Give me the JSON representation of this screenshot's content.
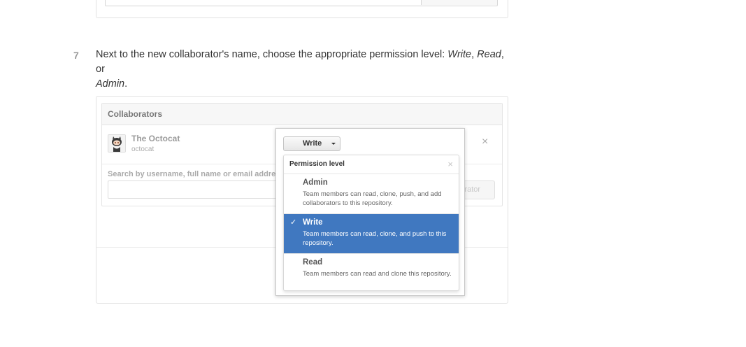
{
  "step": {
    "number": "7",
    "text_before": "Next to the new collaborator's name, choose the appropriate permission level: ",
    "opt1": "Write",
    "sep1": ", ",
    "opt2": "Read",
    "sep2": ", or",
    "opt3": "Admin",
    "end": "."
  },
  "collaborators": {
    "header": "Collaborators",
    "user_name": "The Octocat",
    "user_login": "octocat",
    "remove_icon": "close-icon",
    "search_label": "Search by username, full name or email address",
    "add_button_label": "Add collaborator"
  },
  "permission_menu": {
    "button_label": "Write",
    "header": "Permission level",
    "items": [
      {
        "title": "Admin",
        "desc": "Team members can read, clone, push, and add collaborators to this repository.",
        "selected": false
      },
      {
        "title": "Write",
        "desc": "Team members can read, clone, and push to this repository.",
        "selected": true
      },
      {
        "title": "Read",
        "desc": "Team members can read and clone this repository.",
        "selected": false
      }
    ]
  },
  "colors": {
    "selected_bg": "#4078c0"
  }
}
